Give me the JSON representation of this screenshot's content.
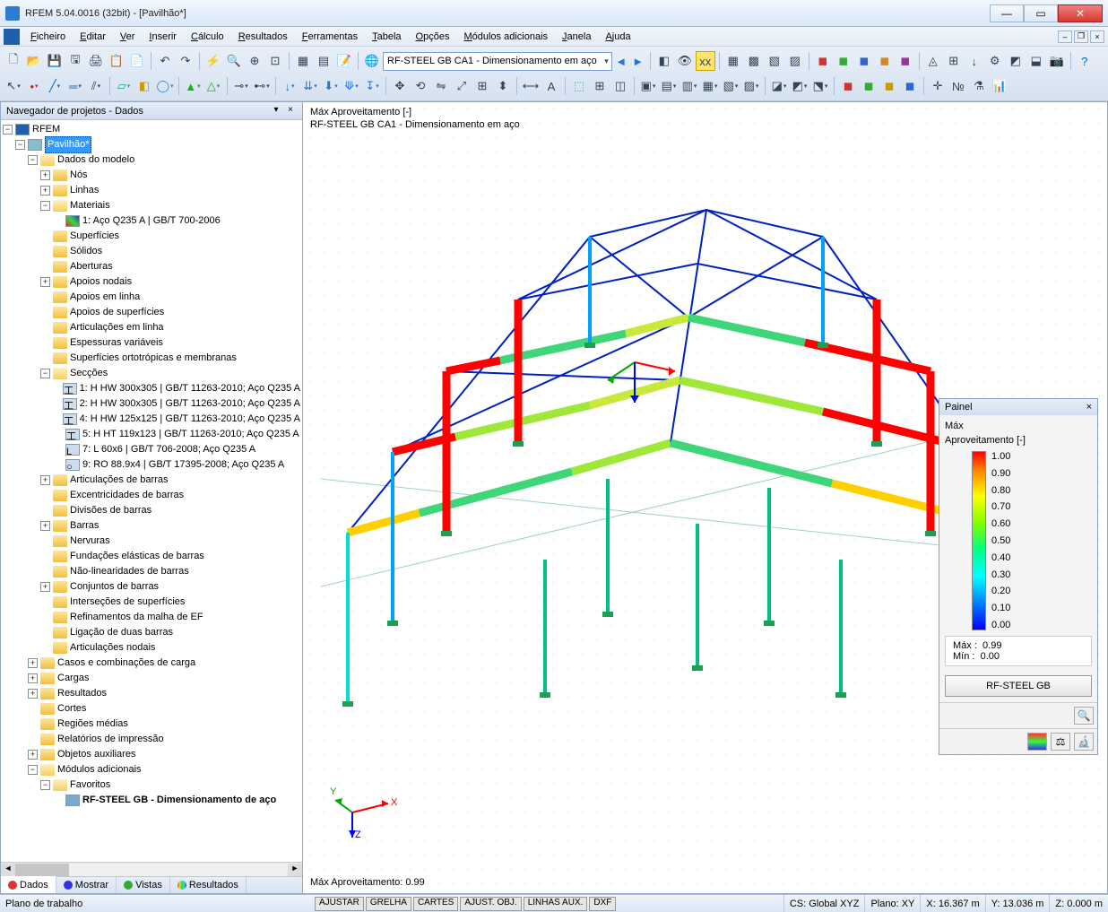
{
  "window": {
    "title": "RFEM 5.04.0016 (32bit) - [Pavilhão*]"
  },
  "menu": [
    "Ficheiro",
    "Editar",
    "Ver",
    "Inserir",
    "Cálculo",
    "Resultados",
    "Ferramentas",
    "Tabela",
    "Opções",
    "Módulos adicionais",
    "Janela",
    "Ajuda"
  ],
  "toolbar_dropdown": "RF-STEEL GB CA1 - Dimensionamento em aço",
  "navigator": {
    "title": "Navegador de projetos - Dados",
    "root": "RFEM",
    "project": "Pavilhão*",
    "model_data": "Dados do modelo",
    "items": {
      "nos": "Nós",
      "linhas": "Linhas",
      "materiais": "Materiais",
      "mat1": "1: Aço Q235 A | GB/T 700-2006",
      "superficies": "Superfícies",
      "solidos": "Sólidos",
      "aberturas": "Aberturas",
      "apoios_nodais": "Apoios nodais",
      "apoios_linha": "Apoios em linha",
      "apoios_sup": "Apoios de superfícies",
      "artic_linha": "Articulações em linha",
      "esp_var": "Espessuras variáveis",
      "sup_orto": "Superfícies ortotrópicas e membranas",
      "seccoes": "Secções",
      "sec1": "1: H HW 300x305 | GB/T 11263-2010; Aço Q235 A",
      "sec2": "2: H HW 300x305 | GB/T 11263-2010; Aço Q235 A",
      "sec4": "4: H HW 125x125 | GB/T 11263-2010; Aço Q235 A",
      "sec5": "5: H HT 119x123 | GB/T 11263-2010; Aço Q235 A",
      "sec7": "7: L 60x6 | GB/T 706-2008; Aço Q235 A",
      "sec9": "9: RO 88.9x4 | GB/T 17395-2008; Aço Q235 A",
      "artic_barras": "Articulações de barras",
      "excentric": "Excentricidades de barras",
      "divisoes": "Divisões de barras",
      "barras": "Barras",
      "nervuras": "Nervuras",
      "fund_elast": "Fundações elásticas de barras",
      "nao_lin": "Não-linearidades de barras",
      "conj_barras": "Conjuntos de barras",
      "intersec": "Interseções de superfícies",
      "refin_malha": "Refinamentos da malha de EF",
      "lig_barras": "Ligação de duas barras",
      "artic_nodais": "Articulações nodais"
    },
    "groups": {
      "casos": "Casos e combinações de carga",
      "cargas": "Cargas",
      "resultados": "Resultados",
      "cortes": "Cortes",
      "regioes": "Regiões médias",
      "relatorios": "Relatórios de impressão",
      "objetos": "Objetos auxiliares",
      "modulos": "Módulos adicionais",
      "favoritos": "Favoritos",
      "rf_steel": "RF-STEEL GB - Dimensionamento de aço"
    },
    "tabs": [
      "Dados",
      "Mostrar",
      "Vistas",
      "Resultados"
    ]
  },
  "viewport": {
    "line1": "Máx Aproveitamento [-]",
    "line2": "RF-STEEL GB CA1 - Dimensionamento em aço",
    "bottom": "Máx Aproveitamento: 0.99",
    "axes": {
      "x": "X",
      "y": "Y",
      "z": "Z"
    }
  },
  "panel": {
    "title": "Painel",
    "sub1": "Máx",
    "sub2": "Aproveitamento [-]",
    "scale": [
      "1.00",
      "0.90",
      "0.80",
      "0.70",
      "0.60",
      "0.50",
      "0.40",
      "0.30",
      "0.20",
      "0.10",
      "0.00"
    ],
    "max_label": "Máx  :",
    "max_val": "0.99",
    "min_label": "Mín   :",
    "min_val": "0.00",
    "button": "RF-STEEL GB"
  },
  "statusbar": {
    "left": "Plano de trabalho",
    "toggles": [
      "AJUSTAR",
      "GRELHA",
      "CARTES",
      "AJUST. OBJ.",
      "LINHAS AUX.",
      "DXF"
    ],
    "cs": "CS: Global XYZ",
    "plano": "Plano: XY",
    "x": "X: 16.367 m",
    "y": "Y: 13.036 m",
    "z": "Z: 0.000 m"
  }
}
